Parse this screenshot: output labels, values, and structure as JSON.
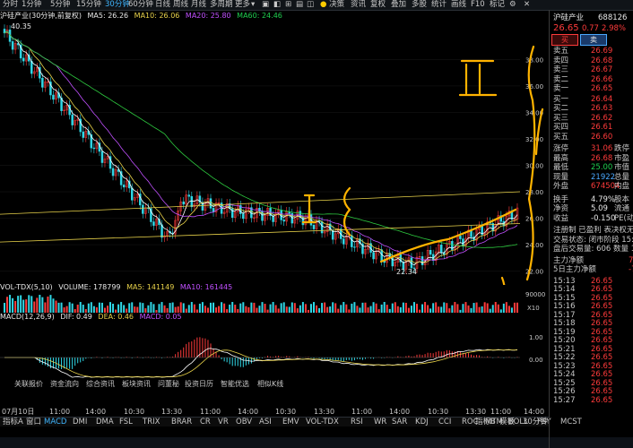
{
  "topbar": {
    "period_tabs": [
      "分时",
      "1分钟",
      "5分钟",
      "15分钟",
      "30分钟",
      "60分钟",
      "日线",
      "周线",
      "月线",
      "多周期",
      "更多"
    ],
    "active_tab": "30分钟",
    "right_items": [
      "决策",
      "资讯",
      "复权",
      "叠加",
      "多股",
      "统计",
      "画线",
      "F10",
      "标记"
    ]
  },
  "chart_info": {
    "title": "沪硅产业(30分钟,前复权)",
    "ma5": "MA5: 26.26",
    "ma10": "MA10: 26.06",
    "ma20": "MA20: 25.80",
    "ma60": "MA60: 24.46",
    "high_label": "40.35",
    "low_label": "22.34"
  },
  "price_axis": [
    "38.00",
    "36.00",
    "34.00",
    "32.00",
    "30.00",
    "28.00",
    "26.00",
    "24.00",
    "22.00"
  ],
  "vol_info": {
    "name": "VOL-TDX(5,10)",
    "vol": "VOLUME: 178799",
    "ma5": "MA5: 141149",
    "ma10": "MA10: 161445"
  },
  "vol_axis": [
    "90000",
    "X10"
  ],
  "macd_info": {
    "name": "MACD(12,26,9)",
    "dif": "DIF: 0.49",
    "dea": "DEA: 0.46",
    "macd": "MACD: 0.05"
  },
  "macd_axis": [
    "1.00",
    "0.00"
  ],
  "sub_tabs": [
    "关联报价",
    "资金流向",
    "综合资讯",
    "板块资讯",
    "问董秘",
    "投资日历",
    "智能优选",
    "相似K线"
  ],
  "time_axis": [
    "07月10日",
    "11:00",
    "14:00",
    "10:30",
    "13:30",
    "11:00",
    "14:00",
    "10:30",
    "13:30",
    "11:00",
    "14:00",
    "10:30",
    "13:30",
    "11:00",
    "14:00"
  ],
  "bottom_tabs": [
    "指标A",
    "窗口",
    "MACD",
    "DMI",
    "DMA",
    "FSL",
    "TRIX",
    "BRAR",
    "CR",
    "VR",
    "OBV",
    "ASI",
    "EMV",
    "VOL-TDX",
    "RSI",
    "WR",
    "SAR",
    "KDJ",
    "CCI",
    "ROC",
    "MTM",
    "BOLL",
    "PSY",
    "MCST"
  ],
  "bottom_tabs_active": "MACD",
  "bottom_right": [
    "指标B",
    "模板"
  ],
  "bottom_period": "30分钟",
  "right_panel": {
    "stock_name": "沪硅产业",
    "stock_code": "688126",
    "price": "26.65",
    "change": "0.77",
    "change_pct": "2.98%",
    "buy_btn": "买",
    "sell_btn": "卖",
    "asks": [
      {
        "label": "卖五",
        "price": "26.69"
      },
      {
        "label": "卖四",
        "price": "26.68"
      },
      {
        "label": "卖三",
        "price": "26.67"
      },
      {
        "label": "卖二",
        "price": "26.66"
      },
      {
        "label": "卖一",
        "price": "26.65"
      }
    ],
    "bids": [
      {
        "label": "买一",
        "price": "26.64"
      },
      {
        "label": "买二",
        "price": "26.63"
      },
      {
        "label": "买三",
        "price": "26.62"
      },
      {
        "label": "买四",
        "price": "26.61"
      },
      {
        "label": "买五",
        "price": "26.60"
      }
    ],
    "stats": [
      {
        "label": "涨停",
        "val": "31.06",
        "extra": "跌停"
      },
      {
        "label": "最高",
        "val": "26.68",
        "extra": "市盈"
      },
      {
        "label": "最低",
        "val": "25.00",
        "extra": "市值"
      },
      {
        "label": "现量",
        "val": "21922",
        "extra": "总量"
      },
      {
        "label": "外盘",
        "val": "674504",
        "extra": "内盘"
      }
    ],
    "stats2": [
      {
        "label": "换手",
        "val": "4.79%",
        "extra": "股本"
      },
      {
        "label": "净资",
        "val": "5.09",
        "extra": "流通"
      },
      {
        "label": "收益",
        "val": "-0.150",
        "extra": "PE(动"
      }
    ],
    "notes": [
      "注册制 已盈利 表决权无",
      "交易状态: 闭市阶段 15:",
      "盘后交易量: 606 数量 15:"
    ],
    "flows": [
      {
        "label": "主力净额",
        "val": "7"
      },
      {
        "label": "5日主力净额",
        "val": "-7"
      }
    ],
    "ticks": [
      {
        "t": "15:13",
        "p": "26.65"
      },
      {
        "t": "15:14",
        "p": "26.65"
      },
      {
        "t": "15:15",
        "p": "26.65"
      },
      {
        "t": "15:16",
        "p": "26.65"
      },
      {
        "t": "15:17",
        "p": "26.65"
      },
      {
        "t": "15:18",
        "p": "26.65"
      },
      {
        "t": "15:19",
        "p": "26.65"
      },
      {
        "t": "15:20",
        "p": "26.65"
      },
      {
        "t": "15:21",
        "p": "26.65"
      },
      {
        "t": "15:22",
        "p": "26.65"
      },
      {
        "t": "15:23",
        "p": "26.65"
      },
      {
        "t": "15:24",
        "p": "26.65"
      },
      {
        "t": "15:25",
        "p": "26.65"
      },
      {
        "t": "15:26",
        "p": "26.65"
      },
      {
        "t": "15:27",
        "p": "26.65"
      }
    ]
  },
  "colors": {
    "up": "#ff3b3b",
    "down": "#1fcf4f",
    "ma5": "#ffffff",
    "ma10": "#e8d24a",
    "ma20": "#c050ff",
    "ma60": "#2ecc40",
    "accent": "#3fb6ff",
    "annotation": "#ffb300"
  }
}
